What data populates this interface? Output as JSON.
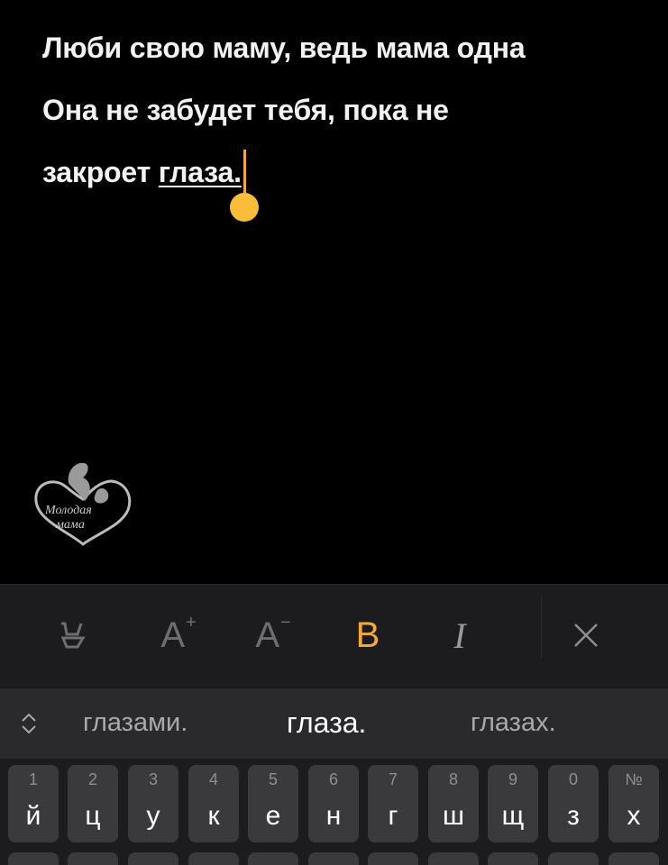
{
  "editor": {
    "lines": [
      "Люби свою маму, ведь мама одна",
      "Она не забудет тебя, пока не",
      "закроет "
    ],
    "underlined_word": "глаза.",
    "cursor_color": "#f3a935"
  },
  "watermark": {
    "logo_text_top": "Молодая",
    "logo_text_bottom": "мама"
  },
  "format_toolbar": {
    "style_icon": "style-brush-icon",
    "increase_label": "A",
    "increase_sup": "+",
    "decrease_label": "A",
    "decrease_sup": "−",
    "bold_label": "B",
    "italic_label": "I",
    "close_icon": "close-icon",
    "active_color": "#f3a935"
  },
  "suggestions": {
    "items": [
      "глазами.",
      "глаза.",
      "глазах."
    ]
  },
  "keyboard": {
    "row1": [
      {
        "hint": "1",
        "key": "й"
      },
      {
        "hint": "2",
        "key": "ц"
      },
      {
        "hint": "3",
        "key": "у"
      },
      {
        "hint": "4",
        "key": "к"
      },
      {
        "hint": "5",
        "key": "е"
      },
      {
        "hint": "6",
        "key": "н"
      },
      {
        "hint": "7",
        "key": "г"
      },
      {
        "hint": "8",
        "key": "ш"
      },
      {
        "hint": "9",
        "key": "щ"
      },
      {
        "hint": "0",
        "key": "з"
      },
      {
        "hint": "№",
        "key": "х"
      }
    ]
  }
}
